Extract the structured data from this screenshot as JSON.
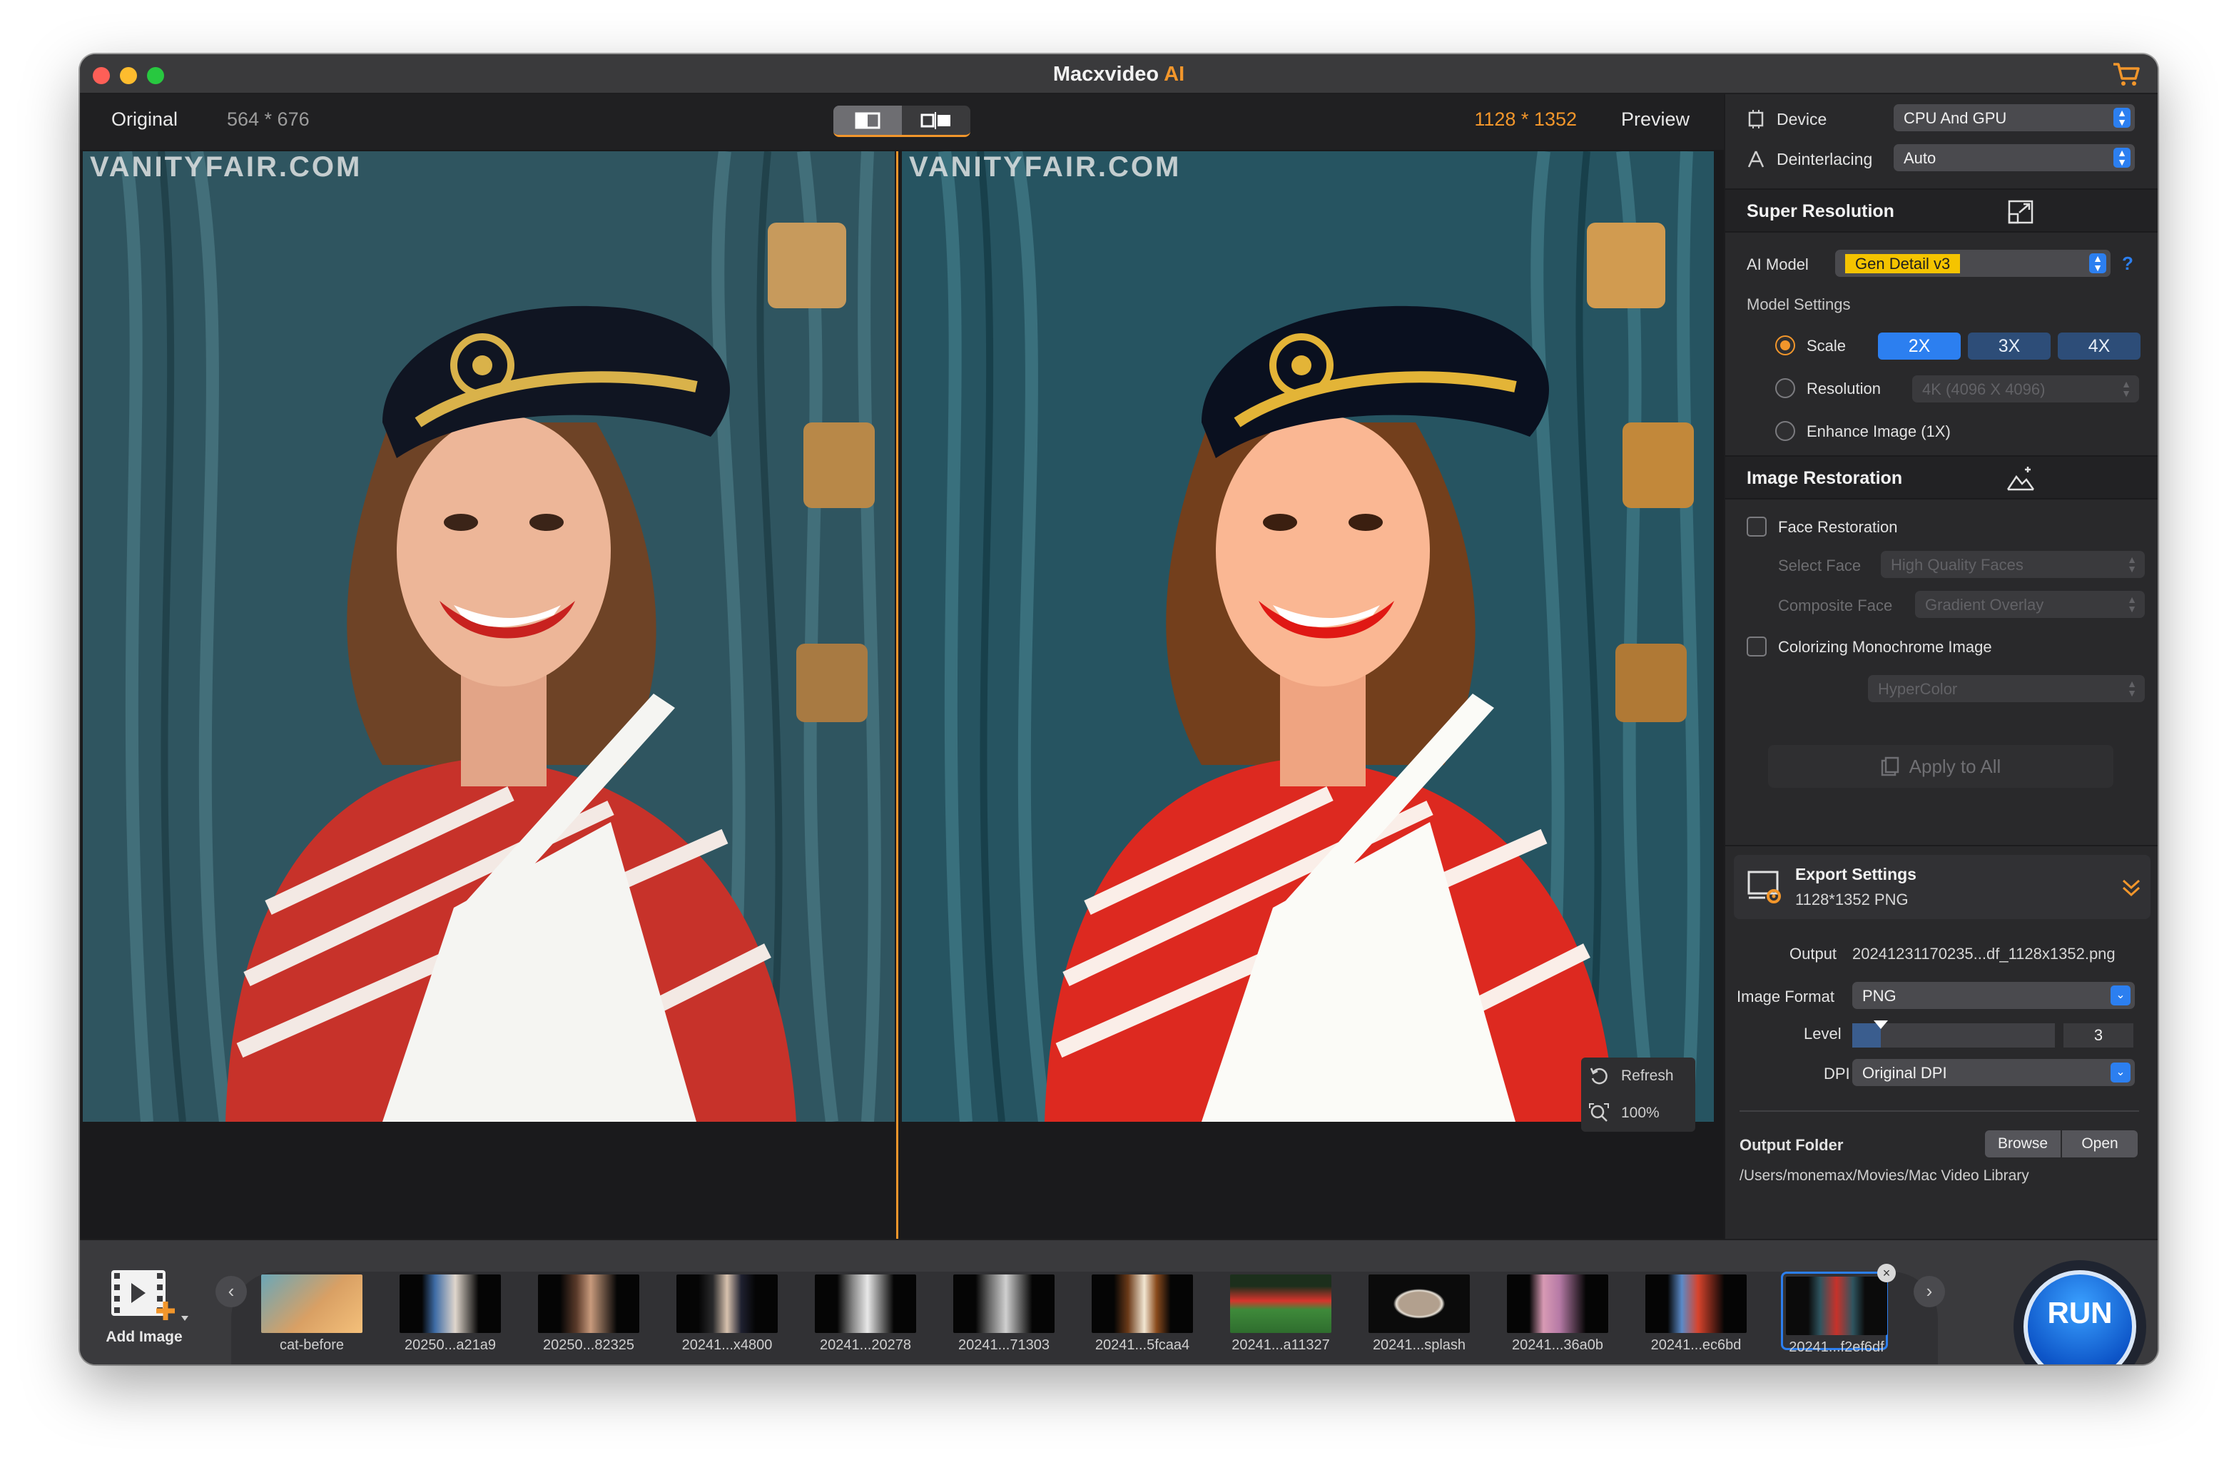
{
  "app": {
    "title": "Macxvideo",
    "title_accent": "AI"
  },
  "viewer": {
    "original_label": "Original",
    "original_size": "564 * 676",
    "preview_size": "1128 * 1352",
    "preview_label": "Preview",
    "watermark": "VANITYFAIR.COM",
    "refresh_label": "Refresh",
    "zoom_label": "100%"
  },
  "panel": {
    "device_label": "Device",
    "device_value": "CPU And GPU",
    "deinterlacing_label": "Deinterlacing",
    "deinterlacing_value": "Auto",
    "super_resolution": {
      "title": "Super Resolution",
      "ai_model_label": "AI Model",
      "ai_model_value": "Gen Detail v3",
      "help": "?",
      "model_settings_label": "Model Settings",
      "scale_label": "Scale",
      "scale_options": [
        "2X",
        "3X",
        "4X"
      ],
      "resolution_label": "Resolution",
      "resolution_value": "4K (4096 X 4096)",
      "enhance_label": "Enhance Image (1X)"
    },
    "image_restoration": {
      "title": "Image Restoration",
      "face_restoration_label": "Face Restoration",
      "select_face_label": "Select Face",
      "select_face_value": "High Quality Faces",
      "composite_face_label": "Composite Face",
      "composite_face_value": "Gradient Overlay",
      "colorize_label": "Colorizing Monochrome Image",
      "colorize_value": "HyperColor",
      "apply_all_label": "Apply to All"
    },
    "export": {
      "title": "Export Settings",
      "summary": "1128*1352 PNG",
      "output_label": "Output",
      "output_value": "20241231170235...df_1128x1352.png",
      "format_label": "Image Format",
      "format_value": "PNG",
      "level_label": "Level",
      "level_value": "3",
      "level_fraction": 0.14,
      "dpi_label": "DPI",
      "dpi_value": "Original DPI",
      "folder_label": "Output Folder",
      "browse_label": "Browse",
      "open_label": "Open",
      "folder_path": "/Users/monemax/Movies/Mac Video Library"
    }
  },
  "filmstrip": {
    "add_label": "Add Image",
    "run_label": "RUN",
    "prev_arrow": "‹",
    "next_arrow": "›",
    "items": [
      {
        "label": "cat-before"
      },
      {
        "label": "20250...a21a9"
      },
      {
        "label": "20250...82325"
      },
      {
        "label": "20241...x4800"
      },
      {
        "label": "20241...20278"
      },
      {
        "label": "20241...71303"
      },
      {
        "label": "20241...5fcaa4"
      },
      {
        "label": "20241...a11327"
      },
      {
        "label": "20241...splash"
      },
      {
        "label": "20241...36a0b"
      },
      {
        "label": "20241...ec6bd"
      },
      {
        "label": "20241...f2ef6df"
      }
    ]
  },
  "colors": {
    "accent": "#f2962b",
    "blue": "#2c7ff0",
    "model_highlight": "#f5c400"
  }
}
